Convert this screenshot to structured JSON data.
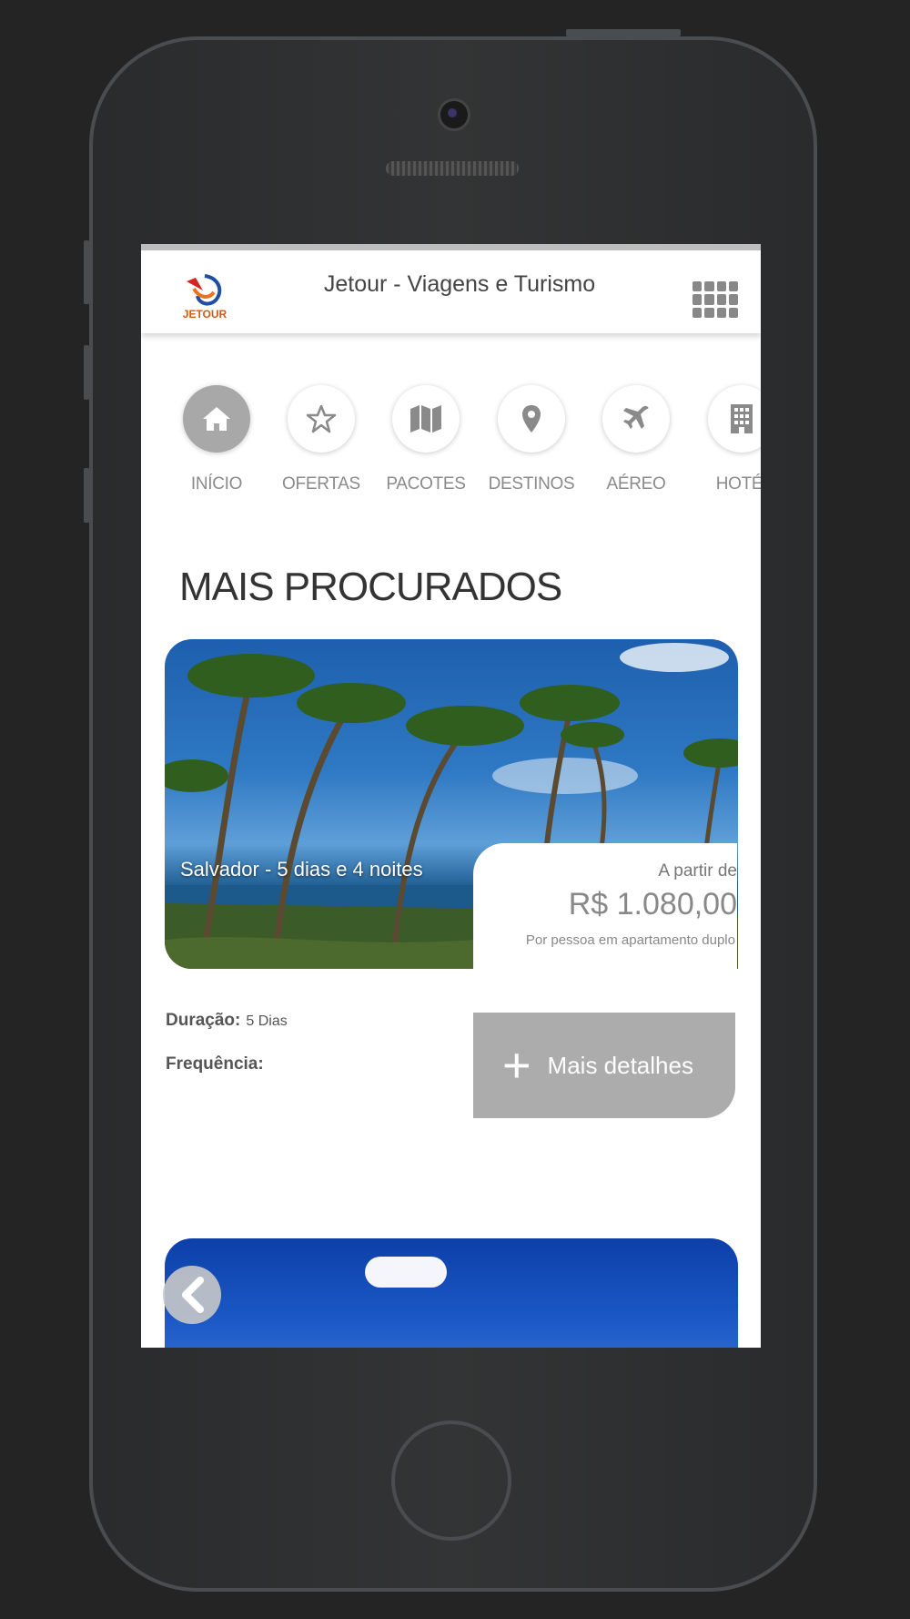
{
  "header": {
    "title": "Jetour - Viagens e Turismo",
    "logo_text": "JETOUR"
  },
  "nav": {
    "items": [
      {
        "label": "INÍCIO",
        "icon": "home-icon",
        "active": true
      },
      {
        "label": "OFERTAS",
        "icon": "star-icon",
        "active": false
      },
      {
        "label": "PACOTES",
        "icon": "map-icon",
        "active": false
      },
      {
        "label": "DESTINOS",
        "icon": "map-pin-icon",
        "active": false
      },
      {
        "label": "AÉREO",
        "icon": "plane-icon",
        "active": false
      },
      {
        "label": "HOTÉI",
        "icon": "building-icon",
        "active": false
      }
    ]
  },
  "section": {
    "title": "MAIS PROCURADOS"
  },
  "package": {
    "destination": "Salvador - 5 dias e 4 noites",
    "price_from": "A partir de",
    "price": "R$ 1.080,00",
    "price_note": "Por pessoa em apartamento duplo",
    "duration_label": "Duração:",
    "duration_value": "5 Dias",
    "frequency_label": "Frequência:",
    "details_button": "Mais detalhes"
  },
  "colors": {
    "accent_gray": "#acacac",
    "background": "#242424"
  }
}
